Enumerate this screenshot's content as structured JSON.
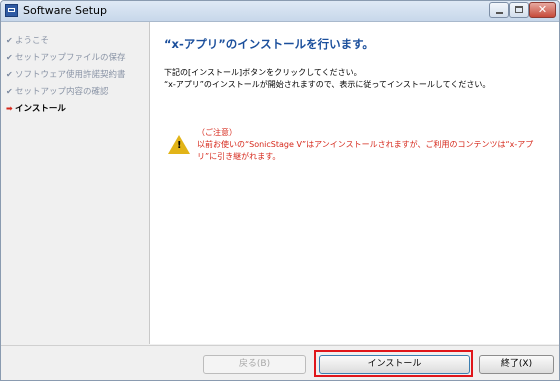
{
  "window": {
    "title": "Software Setup",
    "close_glyph": "✕"
  },
  "sidebar": {
    "items": [
      {
        "marker": "✔",
        "label": "ようこそ"
      },
      {
        "marker": "✔",
        "label": "セットアップファイルの保存"
      },
      {
        "marker": "✔",
        "label": "ソフトウェア使用許諾契約書"
      },
      {
        "marker": "✔",
        "label": "セットアップ内容の確認"
      },
      {
        "marker": "➡",
        "label": "インストール"
      }
    ]
  },
  "main": {
    "heading": "“x-アプリ”のインストールを行います。",
    "desc_line1": "下記の[インストール]ボタンをクリックしてください。",
    "desc_line2": "“x-アプリ”のインストールが開始されますので、表示に従ってインストールしてください。",
    "notice_title": "（ご注意）",
    "notice_body": "以前お使いの“SonicStage V”はアンインストールされますが、ご利用のコンテンツは“x-アプリ”に引き継がれます。",
    "warning_glyph": "!"
  },
  "footer": {
    "back_label": "戻る(B)",
    "install_label": "インストール",
    "exit_label": "終了(X)"
  },
  "colors": {
    "heading": "#1b4f9c",
    "notice": "#d6281b",
    "highlight": "#e0161b"
  },
  "icons": [
    "app-icon",
    "minimize-icon",
    "maximize-icon",
    "close-icon",
    "check-icon",
    "arrow-right-icon",
    "warning-icon"
  ]
}
